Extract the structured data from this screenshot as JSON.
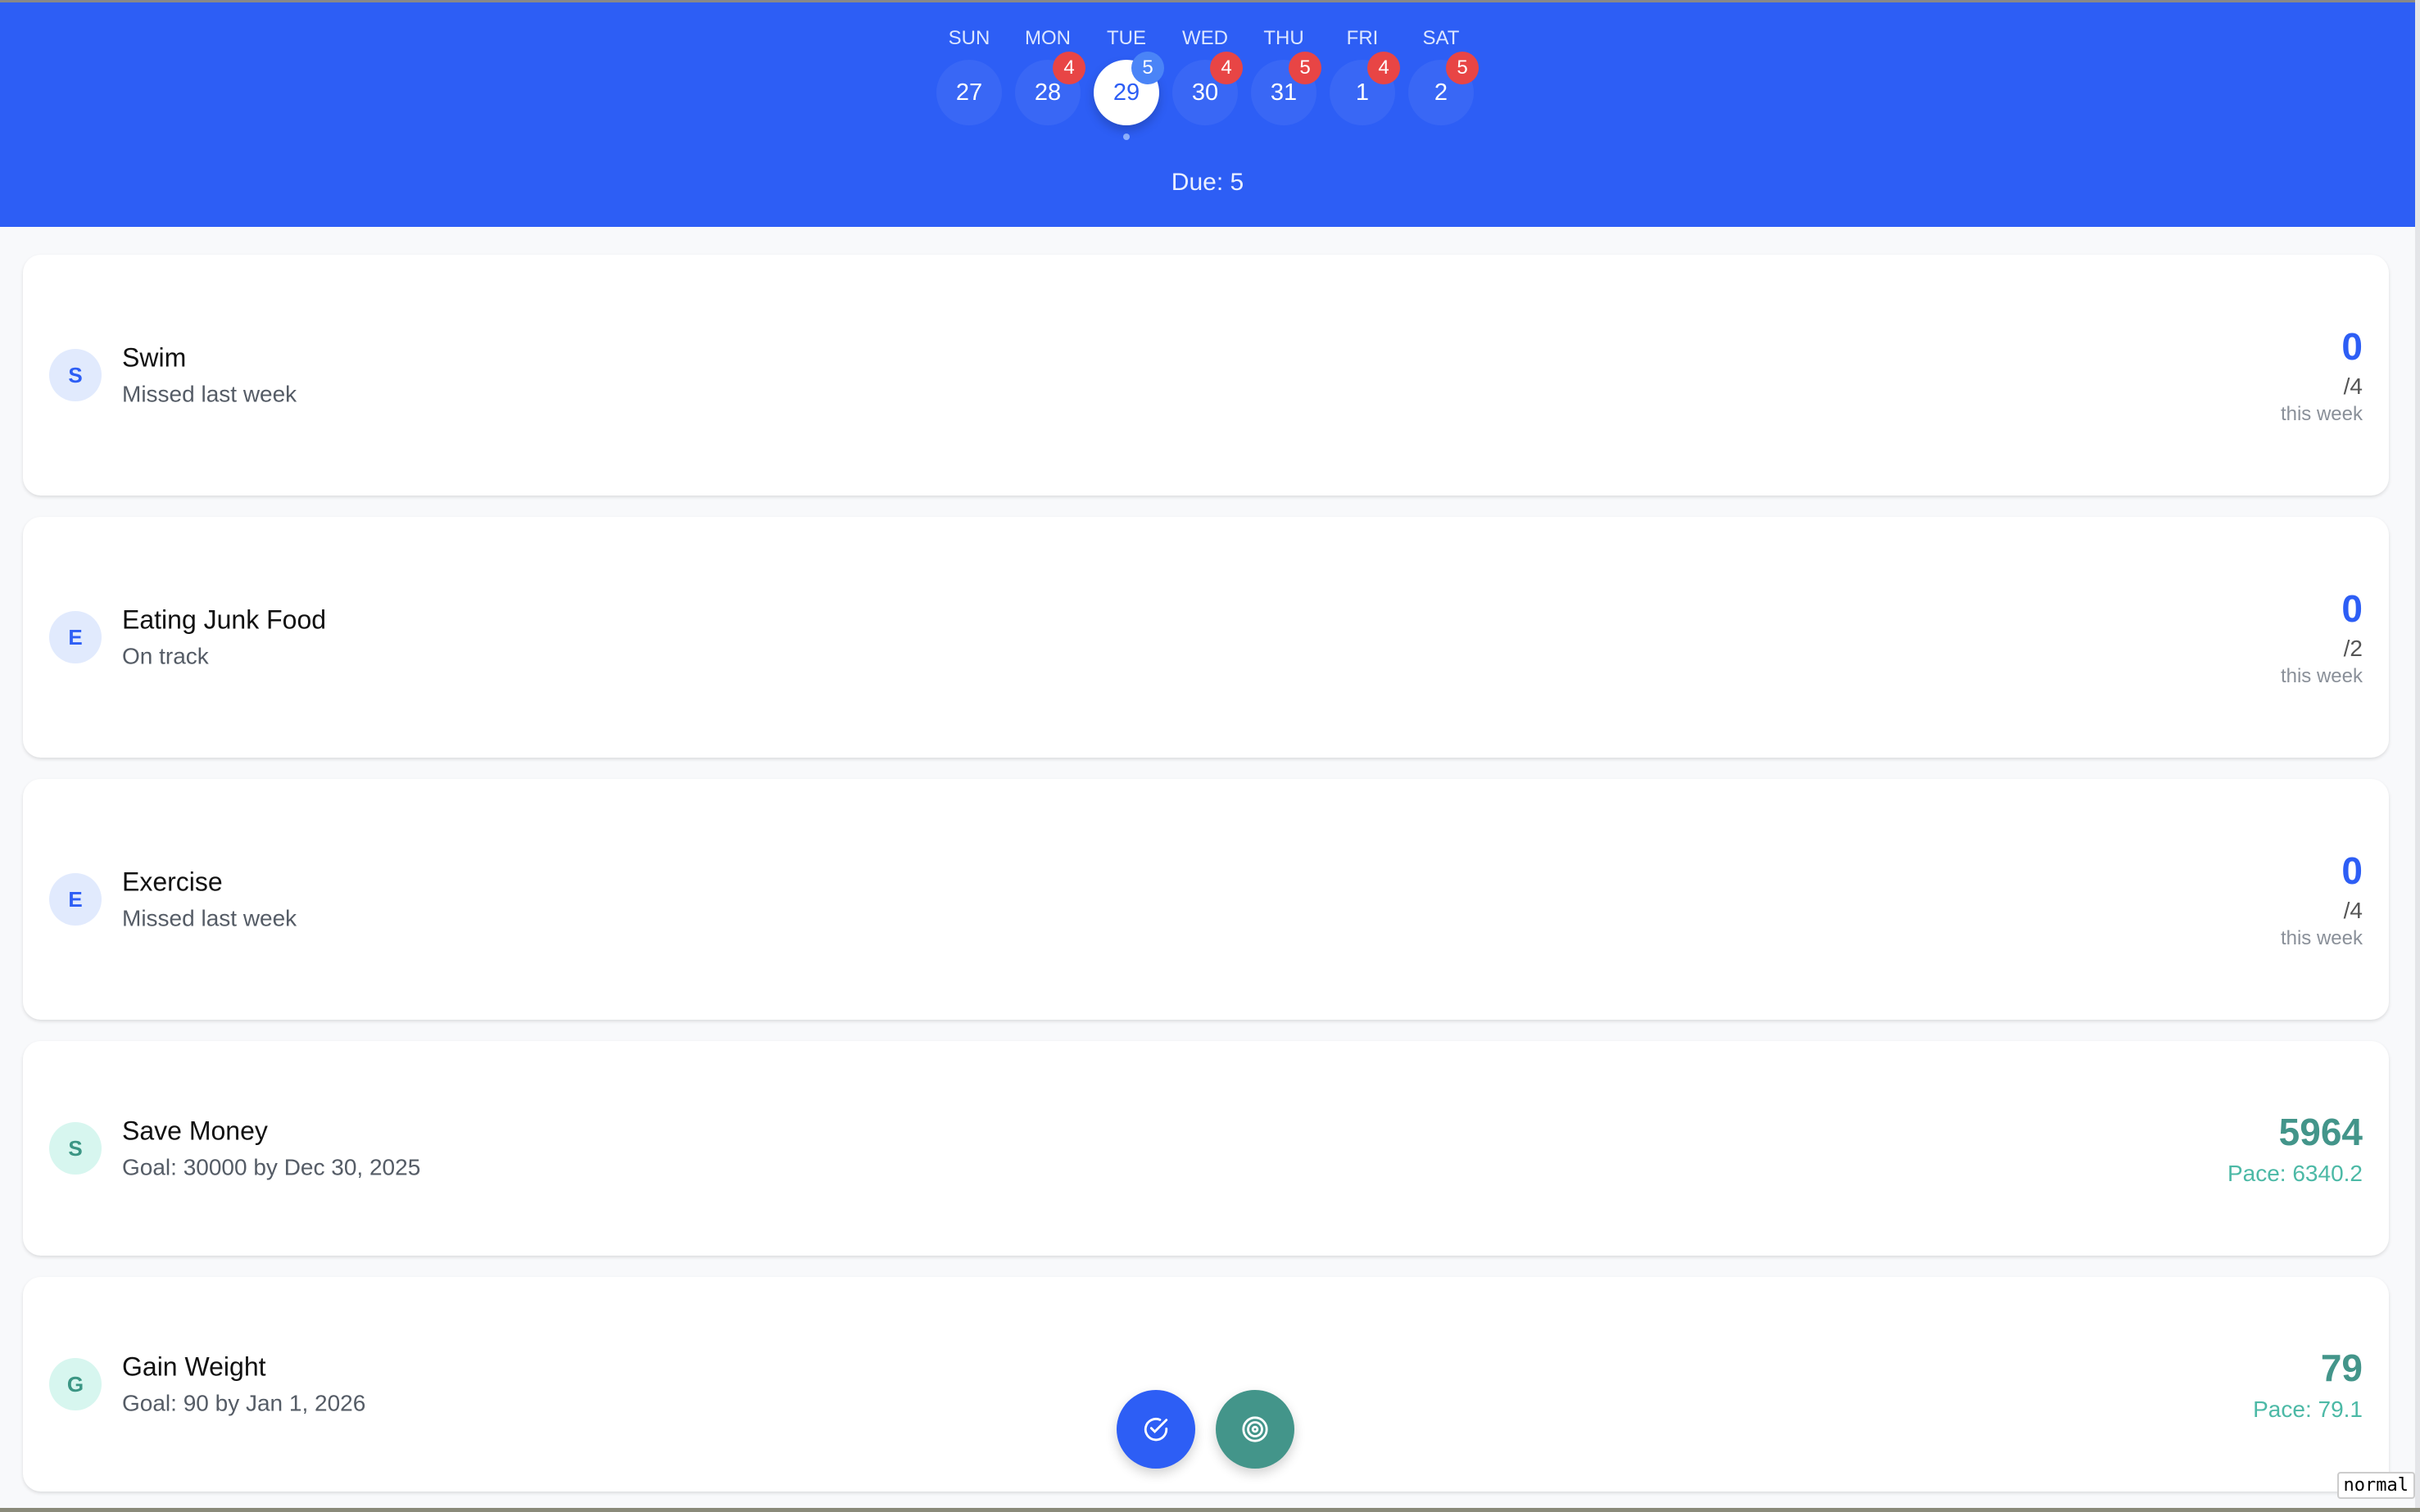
{
  "week": {
    "days": [
      {
        "label": "SUN",
        "date": "27",
        "badge": null,
        "selected": false
      },
      {
        "label": "MON",
        "date": "28",
        "badge": "4",
        "selected": false
      },
      {
        "label": "TUE",
        "date": "29",
        "badge": "5",
        "selected": true
      },
      {
        "label": "WED",
        "date": "30",
        "badge": "4",
        "selected": false
      },
      {
        "label": "THU",
        "date": "31",
        "badge": "5",
        "selected": false
      },
      {
        "label": "FRI",
        "date": "1",
        "badge": "4",
        "selected": false
      },
      {
        "label": "SAT",
        "date": "2",
        "badge": "5",
        "selected": false
      }
    ],
    "due": "Due: 5"
  },
  "habits": [
    {
      "initial": "S",
      "name": "Swim",
      "status": "Missed last week",
      "count": "0",
      "target": "/4",
      "period": "this week",
      "type": "habit"
    },
    {
      "initial": "E",
      "name": "Eating Junk Food",
      "status": "On track",
      "count": "0",
      "target": "/2",
      "period": "this week",
      "type": "habit"
    },
    {
      "initial": "E",
      "name": "Exercise",
      "status": "Missed last week",
      "count": "0",
      "target": "/4",
      "period": "this week",
      "type": "habit"
    },
    {
      "initial": "S",
      "name": "Save Money",
      "status": "Goal: 30000 by Dec 30, 2025",
      "count": "5964",
      "pace": "Pace: 6340.2",
      "type": "goal"
    },
    {
      "initial": "G",
      "name": "Gain Weight",
      "status": "Goal: 90 by Jan 1, 2026",
      "count": "79",
      "pace": "Pace: 79.1",
      "type": "goal"
    }
  ],
  "fabs": [
    {
      "icon": "check-circle-icon",
      "color": "#2d5ef5"
    },
    {
      "icon": "target-icon",
      "color": "#43958a"
    }
  ],
  "mode": "normal"
}
